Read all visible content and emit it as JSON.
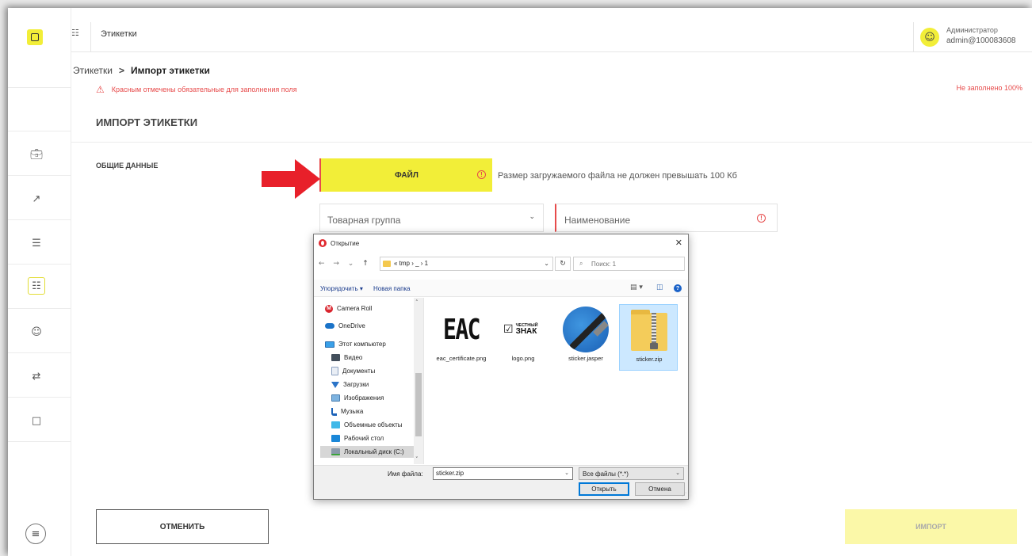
{
  "app": {
    "top_title": "Этикетки",
    "user_role": "Администратор",
    "user_login": "admin@100083608"
  },
  "icons": {
    "logo": "box-icon",
    "apps": "grid-icon",
    "avatar": "user-icon",
    "nav": [
      "briefcase-icon",
      "chart-icon",
      "list-icon",
      "labels-grid-icon",
      "user-check-icon",
      "exchange-icon",
      "document-icon"
    ],
    "menu": "hamburger-icon"
  },
  "breadcrumb": {
    "root": "Этикетки",
    "separator": ">",
    "current": "Импорт этикетки"
  },
  "notice": {
    "required_text": "Красным отмечены обязательные для заполнения поля",
    "progress_text": "Не заполнено 100%"
  },
  "page": {
    "title": "ИМПОРТ ЭТИКЕТКИ",
    "section_label": "ОБЩИЕ ДАННЫЕ"
  },
  "form": {
    "file_button": "ФАЙЛ",
    "file_hint": "Размер загружаемого файла не должен превышать 100 Кб",
    "group_select": "Товарная группа",
    "name_field": "Наименование",
    "cancel_button": "ОТМЕНИТЬ",
    "import_button": "ИМПОРТ"
  },
  "colors": {
    "accent_yellow": "#f2ee38",
    "error_red": "#e74b4b",
    "disabled_yellow": "#fbf8a8"
  },
  "dialog": {
    "title": "Открытие",
    "close": "✕",
    "nav_arrows": "← → ⌄",
    "nav_up": "↑",
    "address": "« tmp › _ › 1",
    "refresh": "↻",
    "search_placeholder": "Поиск: 1",
    "toolbar": {
      "organize": "Упорядочить ▾",
      "new_folder": "Новая папка",
      "views": "▤ ▾",
      "pane": "◫",
      "help": "?"
    },
    "nav_items": [
      {
        "label": "Camera Roll",
        "icon": "mega-icon"
      },
      {
        "label": "OneDrive",
        "icon": "cloud-icon"
      },
      {
        "label": "Этот компьютер",
        "icon": "computer-icon"
      },
      {
        "label": "Видео",
        "icon": "video-icon"
      },
      {
        "label": "Документы",
        "icon": "documents-icon"
      },
      {
        "label": "Загрузки",
        "icon": "downloads-icon"
      },
      {
        "label": "Изображения",
        "icon": "pictures-icon"
      },
      {
        "label": "Музыка",
        "icon": "music-icon"
      },
      {
        "label": "Объемные объекты",
        "icon": "3d-objects-icon"
      },
      {
        "label": "Рабочий стол",
        "icon": "desktop-icon"
      },
      {
        "label": "Локальный диск (C:)",
        "icon": "disk-icon"
      }
    ],
    "files": [
      {
        "name": "eac_certificate.png",
        "thumb_text": "EAC"
      },
      {
        "name": "logo.png",
        "thumb_line1": "ЧЕСТНЫЙ",
        "thumb_line2": "ЗНАК"
      },
      {
        "name": "sticker.jasper"
      },
      {
        "name": "sticker.zip",
        "selected": true
      }
    ],
    "file_name_label": "Имя файла:",
    "file_name_value": "sticker.zip",
    "file_type": "Все файлы (*.*)",
    "open_button": "Открыть",
    "cancel_button": "Отмена"
  }
}
